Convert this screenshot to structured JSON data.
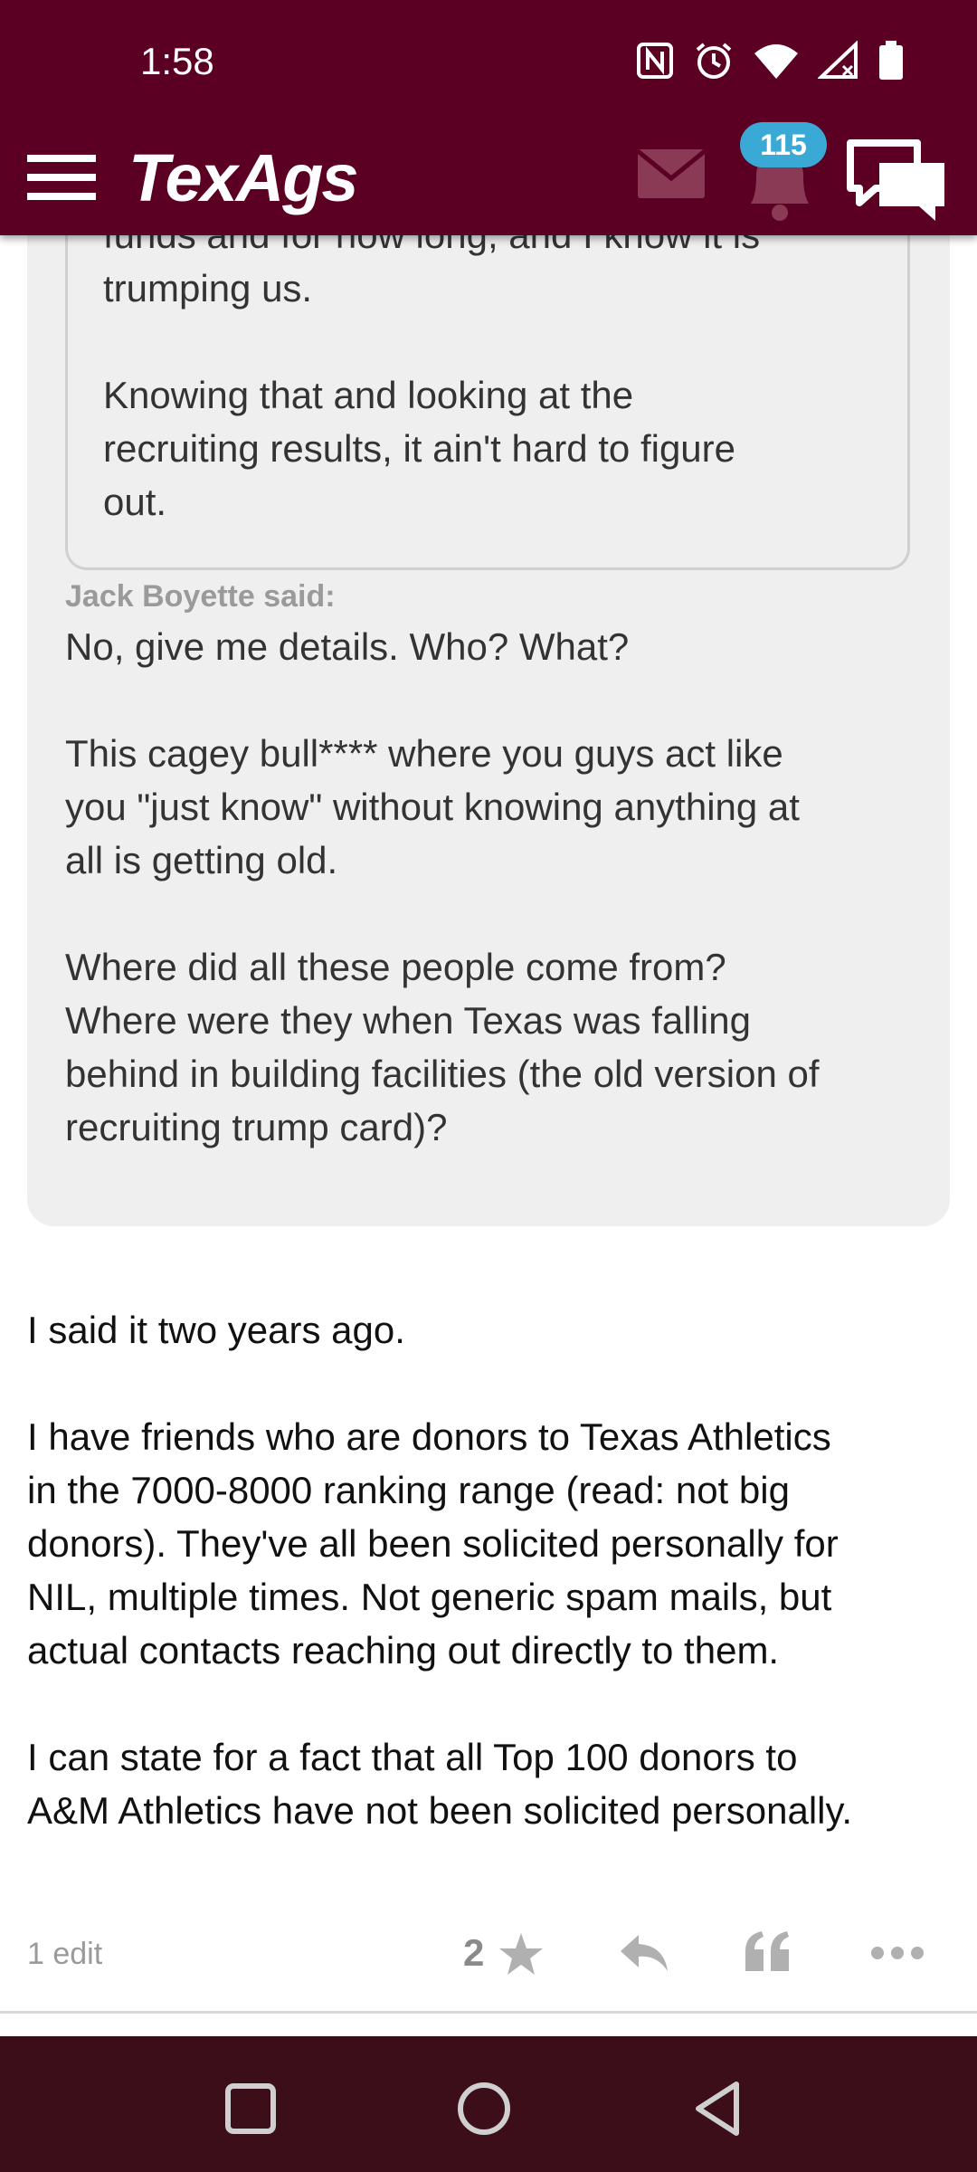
{
  "status_bar": {
    "time": "1:58"
  },
  "header": {
    "logo": "TexAgs",
    "notification_count": "115"
  },
  "quote": {
    "inner_lines": [
      "funds and for how long, and I know it is",
      "trumping us."
    ],
    "inner_para2": [
      "Knowing that and looking at the",
      "recruiting results, it ain't hard to figure",
      "out."
    ],
    "author_label": "Jack Boyette said:",
    "para1": "No, give me details. Who? What?",
    "para2": [
      "This cagey bull**** where you guys act like",
      "you \"just know\" without knowing anything at",
      "all is getting old."
    ],
    "para3": [
      "Where did all these people come from?",
      "Where were they when Texas was falling",
      "behind in building facilities (the old version of",
      "recruiting trump card)?"
    ]
  },
  "post": {
    "para1": "I said it two years ago.",
    "para2": [
      "I have friends who are donors to Texas Athletics",
      "in the 7000-8000 ranking range (read: not big",
      "donors). They've all been solicited personally for",
      "NIL, multiple times. Not generic spam mails, but",
      "actual contacts reaching out directly to them."
    ],
    "para3": [
      "I can state for a fact that all Top 100 donors to",
      "A&M Athletics have not been solicited personally."
    ]
  },
  "footer": {
    "edit_label": "1 edit",
    "star_count": "2"
  },
  "colors": {
    "header_bg": "#5c0023",
    "nav_bg": "#3b0e19",
    "badge": "#3aa9d6"
  },
  "icons": [
    "menu-icon",
    "mail-icon",
    "bell-icon",
    "chat-icon",
    "star-icon",
    "reply-icon",
    "quote-icon",
    "more-icon",
    "square-icon",
    "circle-icon",
    "back-icon"
  ]
}
